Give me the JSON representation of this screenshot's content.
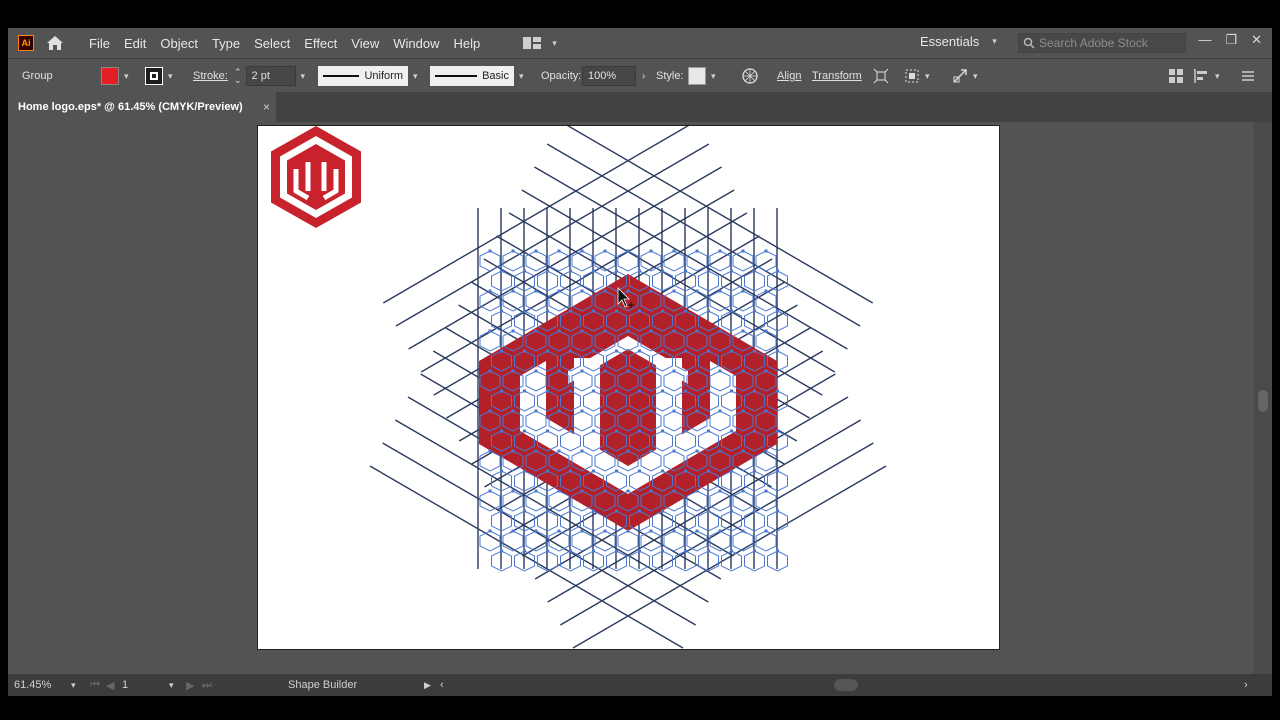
{
  "app": {
    "logo_text": "Ai",
    "window_controls": [
      "minimize-icon",
      "restore-icon",
      "close-icon"
    ]
  },
  "menu": [
    "File",
    "Edit",
    "Object",
    "Type",
    "Select",
    "Effect",
    "View",
    "Window",
    "Help"
  ],
  "workspace": {
    "label": "Essentials"
  },
  "search": {
    "placeholder": "Search Adobe Stock"
  },
  "control": {
    "selection_label": "Group",
    "fill_color": "#e31e24",
    "stroke_label": "Stroke:",
    "stroke_weight": "2 pt",
    "profile_label": "Uniform",
    "brush_label": "Basic",
    "opacity_label": "Opacity:",
    "opacity_value": "100%",
    "style_label": "Style:",
    "align_label": "Align",
    "transform_label": "Transform"
  },
  "document": {
    "tab_title": "Home logo.eps* @ 61.45% (CMYK/Preview)",
    "close": "×"
  },
  "status": {
    "zoom": "61.45%",
    "artboard_number": "1",
    "tool_name": "Shape Builder"
  },
  "colors": {
    "accent_red": "#b2202a",
    "path_blue": "#4a78d0",
    "line_dark": "#2a3a5e"
  }
}
